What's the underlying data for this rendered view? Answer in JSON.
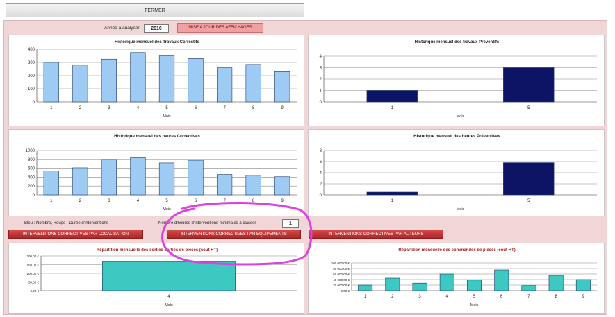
{
  "close_label": "FERMER",
  "controls": {
    "year_label": "Année à analyser",
    "year_value": "2016",
    "update_label": "MISE A JOUR DES AFFICHAGES",
    "legend_note": "Bleu : Nombre, Rouge : Durée d'interventions",
    "min_hours_label": "Nombre d'heures d'interventions minimales à classer",
    "min_hours_value": "1"
  },
  "buttons": {
    "by_location": "INTERVENTIONS CORRECTIVES PAR LOCALISATION",
    "by_equipment": "INTERVENTIONS CORRECTIVES PAR EQUIPEMENTS",
    "by_author": "INTERVENTIONS CORRECTIVES PAR AUTEURS"
  },
  "colors": {
    "light_bar": "#9ecbf4",
    "dark_bar": "#0d1466",
    "teal_bar": "#3dc8c2",
    "annotation": "#e040e0",
    "red_title": "#a01818"
  },
  "chart_data": [
    {
      "id": "c1",
      "type": "bar",
      "title": "Historique mensuel des Travaux Correctifs",
      "categories": [
        "1",
        "2",
        "3",
        "4",
        "5",
        "6",
        "7",
        "8",
        "9"
      ],
      "values": [
        300,
        280,
        325,
        375,
        350,
        330,
        260,
        285,
        230
      ],
      "ylim": [
        0,
        400
      ],
      "yticks": [
        "0",
        "100",
        "200",
        "300",
        "400"
      ],
      "xlabel": "Mois",
      "color": "#9ecbf4"
    },
    {
      "id": "c2",
      "type": "bar",
      "title": "Historique mensuel des travaux Préventifs",
      "categories": [
        "1",
        "5"
      ],
      "values": [
        1,
        3
      ],
      "ylim": [
        0,
        4
      ],
      "yticks": [
        "0",
        "1",
        "2",
        "3",
        "4"
      ],
      "xlabel": "Mois",
      "color": "#0d1466"
    },
    {
      "id": "c3",
      "type": "bar",
      "title": "Historique mensuel des heures Correctives",
      "categories": [
        "1",
        "2",
        "3",
        "4",
        "5",
        "6",
        "7",
        "8",
        "9"
      ],
      "values": [
        540,
        610,
        800,
        840,
        720,
        780,
        460,
        440,
        410
      ],
      "ylim": [
        0,
        1000
      ],
      "yticks": [
        "0",
        "200",
        "400",
        "600",
        "800",
        "1000"
      ],
      "xlabel": "Mois",
      "color": "#9ecbf4"
    },
    {
      "id": "c4",
      "type": "bar",
      "title": "Historique mensuel des heures Préventives",
      "categories": [
        "1",
        "5"
      ],
      "values": [
        0.5,
        5.8
      ],
      "ylim": [
        0,
        8
      ],
      "yticks": [
        "0",
        "2",
        "4",
        "6",
        "8"
      ],
      "xlabel": "Mois",
      "color": "#0d1466"
    },
    {
      "id": "c5",
      "type": "bar",
      "title": "Répartition mensuelle des sorties sorties de pièces (cout HT)",
      "categories": [
        "4"
      ],
      "values": [
        170
      ],
      "ylim": [
        0,
        200
      ],
      "yticks": [
        "0,00 €",
        "50,00 €",
        "100,00 €",
        "150,00 €",
        "200,00 €"
      ],
      "xlabel": "Mois",
      "color": "#3dc8c2"
    },
    {
      "id": "c6",
      "type": "bar",
      "title": "Répartition mensuelle des commandes de pièces (cout HT)",
      "categories": [
        "1",
        "2",
        "3",
        "4",
        "5",
        "6",
        "7",
        "8",
        "9"
      ],
      "values": [
        20000,
        45000,
        27000,
        60000,
        38000,
        75000,
        18000,
        55000,
        40000
      ],
      "ylim": [
        0,
        100000
      ],
      "yticks": [
        "0,00 €",
        "20 000,00 €",
        "40 000,00 €",
        "60 000,00 €",
        "80 000,00 €",
        "100 000,00 €"
      ],
      "xlabel": "Mois",
      "color": "#3dc8c2"
    }
  ]
}
